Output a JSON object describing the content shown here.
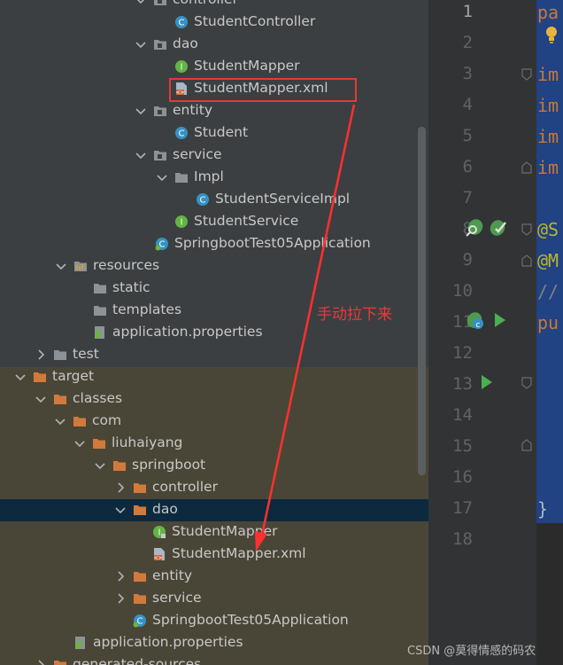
{
  "tree": {
    "rows": [
      {
        "label": "controller",
        "icon": "package-folder-icon",
        "arrow": "down"
      },
      {
        "label": "StudentController",
        "icon": "class-icon",
        "arrow": ""
      },
      {
        "label": "dao",
        "icon": "package-folder-icon",
        "arrow": "down"
      },
      {
        "label": "StudentMapper",
        "icon": "interface-icon",
        "arrow": ""
      },
      {
        "label": "StudentMapper.xml",
        "icon": "xml-file-icon",
        "arrow": ""
      },
      {
        "label": "entity",
        "icon": "package-folder-icon",
        "arrow": "down"
      },
      {
        "label": "Student",
        "icon": "class-icon",
        "arrow": ""
      },
      {
        "label": "service",
        "icon": "package-folder-icon",
        "arrow": "down"
      },
      {
        "label": "Impl",
        "icon": "folder-icon",
        "arrow": "down"
      },
      {
        "label": "StudentServiceImpl",
        "icon": "class-icon",
        "arrow": ""
      },
      {
        "label": "StudentService",
        "icon": "interface-icon",
        "arrow": ""
      },
      {
        "label": "SpringbootTest05Application",
        "icon": "spring-boot-class-icon",
        "arrow": ""
      },
      {
        "label": "resources",
        "icon": "resources-folder-icon",
        "arrow": "down"
      },
      {
        "label": "static",
        "icon": "folder-icon",
        "arrow": ""
      },
      {
        "label": "templates",
        "icon": "folder-icon",
        "arrow": ""
      },
      {
        "label": "application.properties",
        "icon": "properties-file-icon",
        "arrow": ""
      },
      {
        "label": "test",
        "icon": "folder-icon",
        "arrow": "right"
      },
      {
        "label": "target",
        "icon": "excluded-folder-icon",
        "arrow": "down"
      },
      {
        "label": "classes",
        "icon": "excluded-folder-icon",
        "arrow": "down"
      },
      {
        "label": "com",
        "icon": "excluded-folder-icon",
        "arrow": "down"
      },
      {
        "label": "liuhaiyang",
        "icon": "excluded-folder-icon",
        "arrow": "down"
      },
      {
        "label": "springboot",
        "icon": "excluded-folder-icon",
        "arrow": "down"
      },
      {
        "label": "controller",
        "icon": "excluded-folder-icon",
        "arrow": "right"
      },
      {
        "label": "dao",
        "icon": "excluded-folder-icon",
        "arrow": "down"
      },
      {
        "label": "StudentMapper",
        "icon": "locked-interface-icon",
        "arrow": ""
      },
      {
        "label": "StudentMapper.xml",
        "icon": "xml-file-icon",
        "arrow": ""
      },
      {
        "label": "entity",
        "icon": "excluded-folder-icon",
        "arrow": "right"
      },
      {
        "label": "service",
        "icon": "excluded-folder-icon",
        "arrow": "right"
      },
      {
        "label": "SpringbootTest05Application",
        "icon": "spring-boot-class-icon",
        "arrow": ""
      },
      {
        "label": "application.properties",
        "icon": "properties-file-icon",
        "arrow": ""
      },
      {
        "label": "generated-sources",
        "icon": "excluded-folder-icon",
        "arrow": "right"
      }
    ]
  },
  "editor": {
    "line_numbers": [
      "1",
      "2",
      "3",
      "4",
      "5",
      "6",
      "7",
      "8",
      "9",
      "10",
      "11",
      "12",
      "13",
      "14",
      "15",
      "16",
      "17",
      "18"
    ],
    "active_line": "1",
    "code_fragments": [
      {
        "line": "1",
        "text": "pa",
        "color": "#cc7832"
      },
      {
        "line": "3",
        "text": "im",
        "color": "#cc7832"
      },
      {
        "line": "4",
        "text": "im",
        "color": "#cc7832"
      },
      {
        "line": "5",
        "text": "im",
        "color": "#cc7832"
      },
      {
        "line": "6",
        "text": "im",
        "color": "#cc7832"
      },
      {
        "line": "8",
        "text": "@S",
        "color": "#bbb529"
      },
      {
        "line": "9",
        "text": "@M",
        "color": "#bbb529"
      },
      {
        "line": "10",
        "text": "//",
        "color": "#808080"
      },
      {
        "line": "11",
        "text": "pu",
        "color": "#cc7832"
      },
      {
        "line": "17",
        "text": "}",
        "color": "#a9b7c6"
      }
    ],
    "gutter_icons": [
      "bulb-icon",
      "bean-search-icon",
      "run-icon",
      "fold-icon"
    ]
  },
  "annotation": {
    "text": "手动拉下来",
    "color": "#e83a3a"
  },
  "watermark": {
    "text": "CSDN @莫得情感的码农"
  },
  "colors": {
    "highlight_box": "#e53935",
    "arrow": "#ff3030",
    "selection": "#0d293e"
  }
}
